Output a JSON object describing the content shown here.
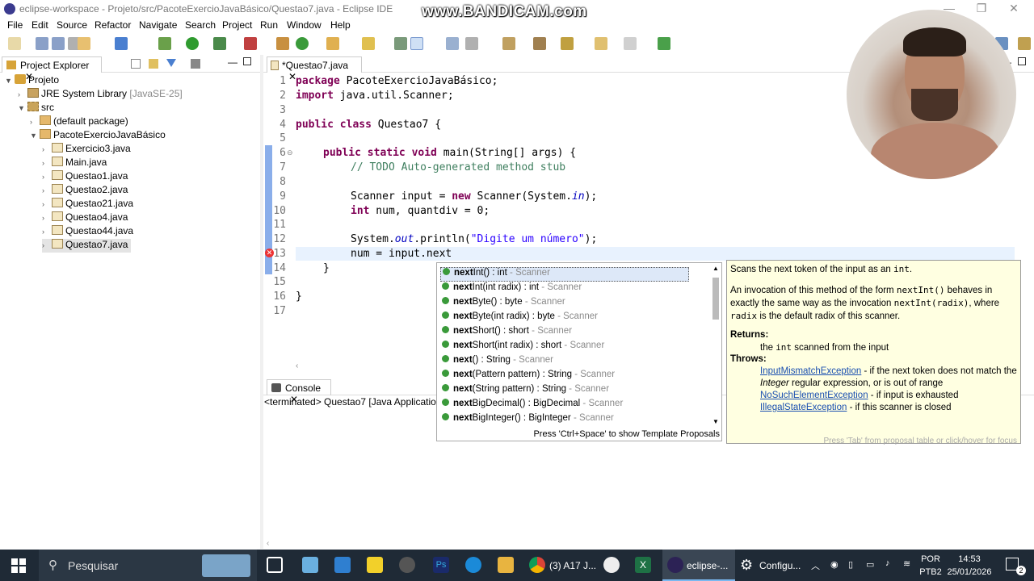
{
  "window": {
    "title": "eclipse-workspace - Projeto/src/PacoteExercioJavaBásico/Questao7.java - Eclipse IDE",
    "watermark": "www.BANDICAM.com"
  },
  "menu": [
    "File",
    "Edit",
    "Source",
    "Refactor",
    "Navigate",
    "Search",
    "Project",
    "Run",
    "Window",
    "Help"
  ],
  "project_explorer": {
    "tab_label": "Project Explorer",
    "tree": [
      {
        "label": "Projeto",
        "suffix": ""
      },
      {
        "label": "JRE System Library",
        "suffix": "[JavaSE-25]"
      },
      {
        "label": "src",
        "suffix": ""
      },
      {
        "label": "(default package)",
        "suffix": ""
      },
      {
        "label": "PacoteExercioJavaBásico",
        "suffix": ""
      },
      {
        "label": "Exercicio3.java",
        "suffix": ""
      },
      {
        "label": "Main.java",
        "suffix": ""
      },
      {
        "label": "Questao1.java",
        "suffix": ""
      },
      {
        "label": "Questao2.java",
        "suffix": ""
      },
      {
        "label": "Questao21.java",
        "suffix": ""
      },
      {
        "label": "Questao4.java",
        "suffix": ""
      },
      {
        "label": "Questao44.java",
        "suffix": ""
      },
      {
        "label": "Questao7.java",
        "suffix": ""
      }
    ]
  },
  "editor": {
    "tab_label": "*Questao7.java",
    "line_numbers": [
      "1",
      "2",
      "3",
      "4",
      "5",
      "6",
      "7",
      "8",
      "9",
      "10",
      "11",
      "12",
      "13",
      "14",
      "15",
      "16",
      "17"
    ],
    "lines": {
      "l1_kw": "package",
      "l1_rest": " PacoteExercioJavaBásico;",
      "l2_kw": "import",
      "l2_rest": " java.util.Scanner;",
      "l4_kw": "public class",
      "l4_rest": " Questao7 {",
      "l6_kw": "public static void",
      "l6_rest": " main(String[] args) {",
      "l7_cm": "// TODO Auto-generated method stub",
      "l9_a": "Scanner input = ",
      "l9_kw": "new",
      "l9_b": " Scanner(System.",
      "l9_fld": "in",
      "l9_c": ");",
      "l10_kw": "int",
      "l10_rest": " num, quantdiv = 0;",
      "l12_a": "System.",
      "l12_fld": "out",
      "l12_b": ".println(",
      "l12_st": "\"Digite um número\"",
      "l12_c": ");",
      "l13": "num = input.next",
      "l14": "}",
      "l16": "}"
    }
  },
  "proposals": {
    "items": [
      {
        "bold": "next",
        "rest": "Int() : int",
        "qual": " - Scanner"
      },
      {
        "bold": "next",
        "rest": "Int(int radix) : int",
        "qual": " - Scanner"
      },
      {
        "bold": "next",
        "rest": "Byte() : byte",
        "qual": " - Scanner"
      },
      {
        "bold": "next",
        "rest": "Byte(int radix) : byte",
        "qual": " - Scanner"
      },
      {
        "bold": "next",
        "rest": "Short() : short",
        "qual": " - Scanner"
      },
      {
        "bold": "next",
        "rest": "Short(int radix) : short",
        "qual": " - Scanner"
      },
      {
        "bold": "next",
        "rest": "() : String",
        "qual": " - Scanner"
      },
      {
        "bold": "next",
        "rest": "(Pattern pattern) : String",
        "qual": " - Scanner"
      },
      {
        "bold": "next",
        "rest": "(String pattern) : String",
        "qual": " - Scanner"
      },
      {
        "bold": "next",
        "rest": "BigDecimal() : BigDecimal",
        "qual": " - Scanner"
      },
      {
        "bold": "next",
        "rest": "BigInteger() : BigInteger",
        "qual": " - Scanner"
      }
    ],
    "hint": "Press 'Ctrl+Space' to show Template Proposals"
  },
  "javadoc": {
    "summary_a": "Scans the next token of the input as an ",
    "summary_code": "int",
    "summary_b": ".",
    "p2_a": "An invocation of this method of the form ",
    "p2_code1": "nextInt()",
    "p2_b": " behaves in exactly the same way as the invocation ",
    "p2_code2": "nextInt(radix)",
    "p2_c": ", where ",
    "p2_code3": "radix",
    "p2_d": " is the default radix of this scanner.",
    "returns_label": "Returns:",
    "returns_a": "the ",
    "returns_code": "int",
    "returns_b": " scanned from the input",
    "throws_label": "Throws:",
    "t1_link": "InputMismatchException",
    "t1_a": " - if the next token does not match the ",
    "t1_it": "Integer",
    "t1_b": " regular expression, or is out of range",
    "t2_link": "NoSuchElementException",
    "t2_text": " - if input is exhausted",
    "t3_link": "IllegalStateException",
    "t3_text": " - if this scanner is closed",
    "footer": "Press 'Tab' from proposal table or click/hover for focus"
  },
  "console": {
    "tab_label": "Console",
    "status": "<terminated> Questao7 [Java Application]"
  },
  "taskbar": {
    "search_placeholder": "Pesquisar",
    "app_chrome_label": "(3) A17 J...",
    "app_eclipse_label": "eclipse-...",
    "app_settings_label": "Configu...",
    "lang_top": "POR",
    "lang_bottom": "PTB2",
    "time": "14:53",
    "date": "25/01/2026",
    "notif_count": "2"
  },
  "colors": {
    "keyword": "#7f0055",
    "comment": "#3f7f5f",
    "string": "#2a00ff",
    "field": "#0000c0",
    "javadoc_bg": "#ffffe1",
    "taskbar_bg": "#1f2a36"
  }
}
